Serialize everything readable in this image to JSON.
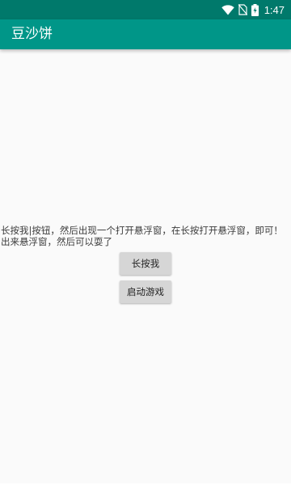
{
  "status_bar": {
    "time": "1:47",
    "icons": [
      "wifi-icon",
      "no-sim-icon",
      "battery-icon"
    ]
  },
  "app_bar": {
    "title": "豆沙饼"
  },
  "main": {
    "message": "长按我|按钮，然后出现一个打开悬浮窗，在长按打开悬浮窗，即可！出来悬浮窗，然后可以耍了",
    "long_press_button_label": "长按我",
    "start_game_button_label": "启动游戏"
  },
  "colors": {
    "status_bar": "#00796b",
    "app_bar": "#009688",
    "background": "#fafafa",
    "button": "#d6d6d6"
  }
}
